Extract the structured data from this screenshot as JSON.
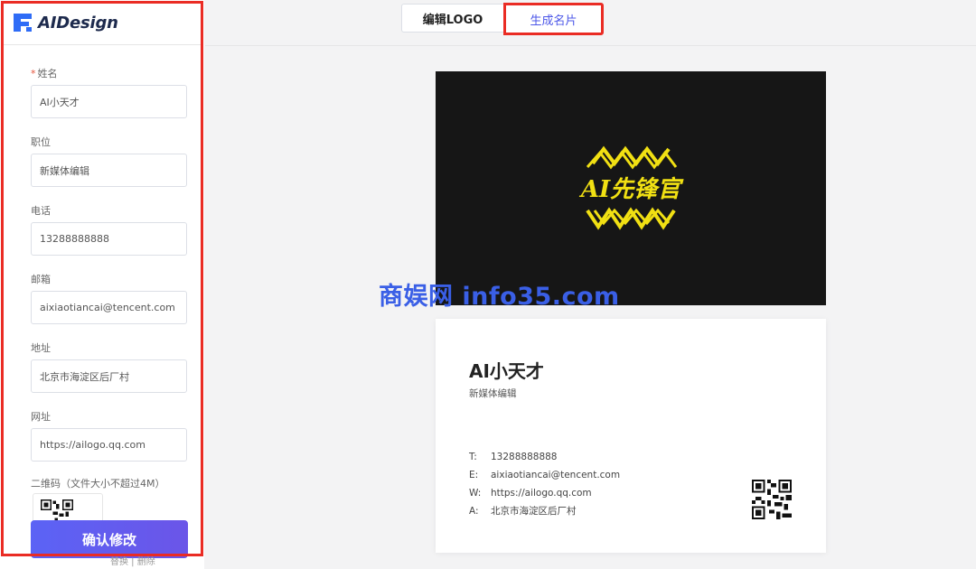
{
  "app": {
    "name": "AIDesign"
  },
  "tabs": [
    {
      "label": "编辑LOGO",
      "active": false
    },
    {
      "label": "生成名片",
      "active": true
    }
  ],
  "form": {
    "name_label": "姓名",
    "name_value": "AI小天才",
    "position_label": "职位",
    "position_value": "新媒体编辑",
    "phone_label": "电话",
    "phone_value": "13288888888",
    "email_label": "邮箱",
    "email_value": "aixiaotiancai@tencent.com",
    "address_label": "地址",
    "address_value": "北京市海淀区后厂村",
    "website_label": "网址",
    "website_value": "https://ailogo.qq.com",
    "qr_label": "二维码（文件大小不超过4M）",
    "confirm_label": "确认修改",
    "below_links": "替换 | 删除"
  },
  "card_front": {
    "logo_text": "AI先锋官",
    "logo_color": "#f1e013"
  },
  "card_back": {
    "name": "AI小天才",
    "title": "新媒体编辑",
    "lines": [
      {
        "key": "T:",
        "value": "13288888888"
      },
      {
        "key": "E:",
        "value": "aixiaotiancai@tencent.com"
      },
      {
        "key": "W:",
        "value": "https://ailogo.qq.com"
      },
      {
        "key": "A:",
        "value": "北京市海淀区后厂村"
      }
    ]
  },
  "watermark": "商娱网 info35.com",
  "colors": {
    "accent": "#4c57e8",
    "highlight_box": "#ea2c24",
    "card_dark": "#161616"
  }
}
